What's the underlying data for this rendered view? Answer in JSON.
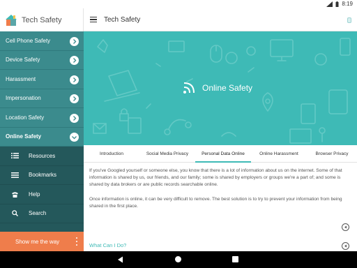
{
  "status_bar": {
    "time": "8:19",
    "wifi_icon": "wifi-icon",
    "battery_icon": "battery-icon"
  },
  "sidebar": {
    "app_title": "Tech Safety",
    "logo_icon": "house-logo-icon",
    "items": [
      {
        "label": "Cell Phone Safety",
        "icon": "chevron-right-icon"
      },
      {
        "label": "Device Safety",
        "icon": "chevron-right-icon"
      },
      {
        "label": "Harassment",
        "icon": "chevron-right-icon"
      },
      {
        "label": "Impersonation",
        "icon": "chevron-right-icon"
      },
      {
        "label": "Location Safety",
        "icon": "chevron-right-icon"
      },
      {
        "label": "Online Safety",
        "icon": "chevron-right-icon",
        "active": true
      }
    ],
    "sub_items": [
      {
        "label": "Resources",
        "icon": "list-icon"
      },
      {
        "label": "Bookmarks",
        "icon": "bookmark-icon"
      },
      {
        "label": "Help",
        "icon": "phone-icon"
      },
      {
        "label": "Search",
        "icon": "search-icon"
      }
    ],
    "cta_label": "Show me the way"
  },
  "topbar": {
    "title": "Tech Safety"
  },
  "hero": {
    "title": "Online Safety",
    "icon": "rss-icon"
  },
  "tabs": [
    {
      "label": "Introduction"
    },
    {
      "label": "Social Media Privacy"
    },
    {
      "label": "Personal Data Online",
      "active": true
    },
    {
      "label": "Online Harassment"
    },
    {
      "label": "Browser Privacy"
    }
  ],
  "content": {
    "paragraphs": [
      "If you've Googled yourself or someone else, you know that there is a lot of information about us on the internet. Some of that information is shared by us, our friends, and our family; some is shared by employers or groups we're a part of; and some is shared by data brokers or are public records searchable online.",
      "Once information is online, it can be very difficult to remove. The best solution is to try to prevent your information from being shared in the first place."
    ],
    "link": "What Can I Do?"
  },
  "colors": {
    "teal": "#3ebab6",
    "sidebar": "#3b8b8d",
    "sidebar_dark": "#24585b",
    "cta": "#ef7d4b"
  }
}
